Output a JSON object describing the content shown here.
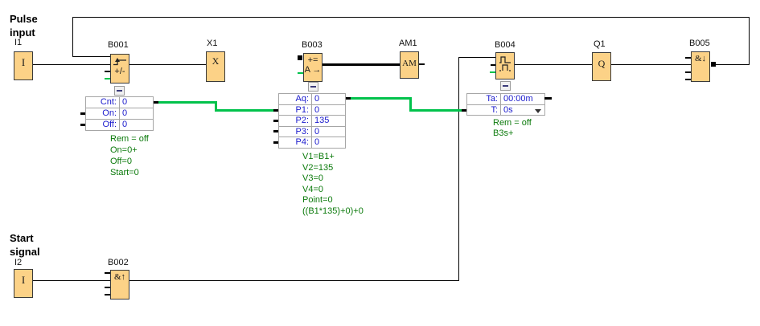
{
  "annotations": {
    "pulse_input": [
      "Pulse",
      "input"
    ],
    "start_signal": [
      "Start",
      "signal"
    ]
  },
  "blocks": {
    "i1": {
      "label": "I1",
      "glyph": "I"
    },
    "b001": {
      "label": "B001",
      "glyph": "+/-"
    },
    "x1": {
      "label": "X1",
      "glyph": "X"
    },
    "b003": {
      "label": "B003",
      "glyph_top": "+=",
      "glyph_bottom": "A →"
    },
    "am1": {
      "label": "AM1",
      "glyph": "AM"
    },
    "b004": {
      "label": "B004"
    },
    "q1": {
      "label": "Q1",
      "glyph": "Q"
    },
    "b005": {
      "label": "B005",
      "glyph": "&↓"
    },
    "i2": {
      "label": "I2",
      "glyph": "I"
    },
    "b002": {
      "label": "B002",
      "glyph": "&↑"
    }
  },
  "param_boxes": {
    "b001": {
      "rows": [
        {
          "label": "Cnt:",
          "value": "0"
        },
        {
          "label": "On:",
          "value": "0"
        },
        {
          "label": "Off:",
          "value": "0"
        }
      ],
      "notes": [
        "Rem = off",
        "On=0+",
        "Off=0",
        "Start=0"
      ]
    },
    "b003": {
      "rows": [
        {
          "label": "Aq:",
          "value": "0"
        },
        {
          "label": "P1:",
          "value": "0"
        },
        {
          "label": "P2:",
          "value": "135"
        },
        {
          "label": "P3:",
          "value": "0"
        },
        {
          "label": "P4:",
          "value": "0"
        }
      ],
      "notes": [
        "V1=B1+",
        "V2=135",
        "V3=0",
        "V4=0",
        "Point=0",
        "((B1*135)+0)+0"
      ]
    },
    "b004": {
      "rows": [
        {
          "label": "Ta:",
          "value": "00:00m"
        },
        {
          "label": "T:",
          "value": "0s"
        }
      ],
      "notes": [
        "Rem = off",
        "B3s+"
      ]
    }
  },
  "colors": {
    "block_fill": "#FCD287",
    "block_border": "#3A3A3A",
    "wire_black": "#000000",
    "wire_green": "#00C24B",
    "text_green": "#0B7A0B",
    "text_blue": "#1919CC",
    "box_border": "#A6A6A6"
  }
}
